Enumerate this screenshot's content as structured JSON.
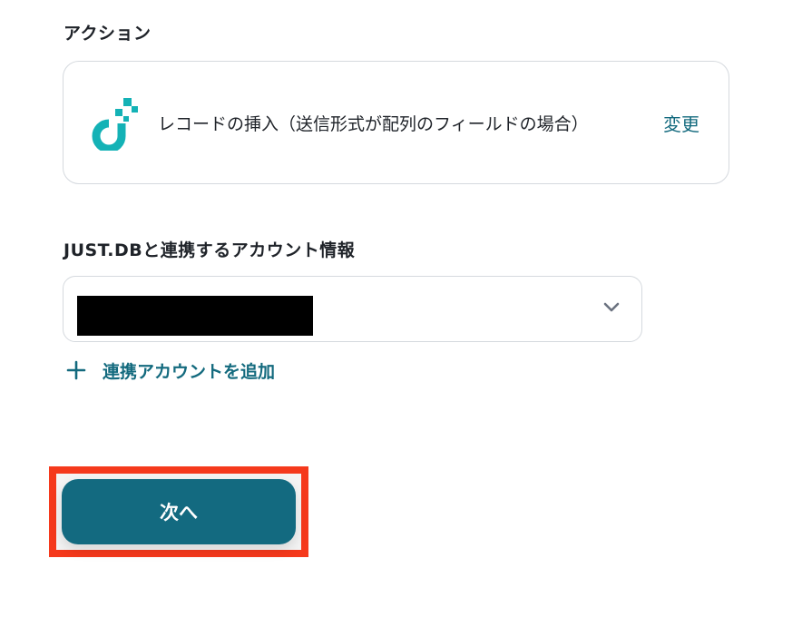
{
  "action_section": {
    "label": "アクション",
    "card": {
      "app_icon": "just-db-logo-icon",
      "action_name": "レコードの挿入（送信形式が配列のフィールドの場合）",
      "change_label": "変更"
    }
  },
  "account_section": {
    "label": "JUST.DBと連携するアカウント情報",
    "selected_value": "",
    "add_account_label": "連携アカウントを追加"
  },
  "footer": {
    "next_label": "次へ"
  },
  "colors": {
    "accent": "#136a7e",
    "button": "#136a80",
    "logo": "#14b2b6",
    "highlight": "#f5391c"
  }
}
